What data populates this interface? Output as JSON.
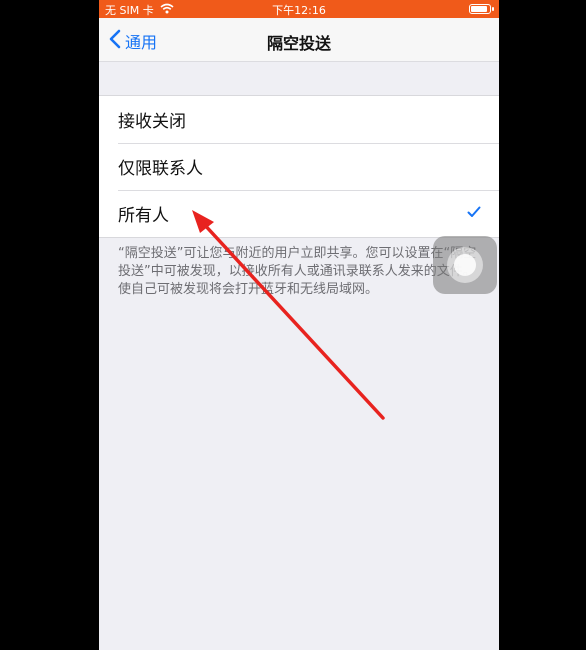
{
  "status_bar": {
    "carrier": "无 SIM 卡",
    "time": "下午12:16",
    "background_color": "#f05a1a"
  },
  "nav": {
    "back_label": "通用",
    "title": "隔空投送",
    "accent_color": "#1673f5"
  },
  "options": [
    {
      "label": "接收关闭",
      "selected": false
    },
    {
      "label": "仅限联系人",
      "selected": false
    },
    {
      "label": "所有人",
      "selected": true
    }
  ],
  "footer_note": "“隔空投送”可让您与附近的用户立即共享。您可以设置在“隔空投送”中可被发现，以接收所有人或通讯录联系人发来的文件。使自己可被发现将会打开蓝牙和无线局域网。",
  "annotation": {
    "arrow_color": "#e8231f"
  },
  "icons": {
    "wifi": "wifi-icon",
    "battery": "battery-icon",
    "back": "chevron-left-icon",
    "check": "checkmark-icon",
    "assistive_touch": "assistive-touch-icon"
  }
}
